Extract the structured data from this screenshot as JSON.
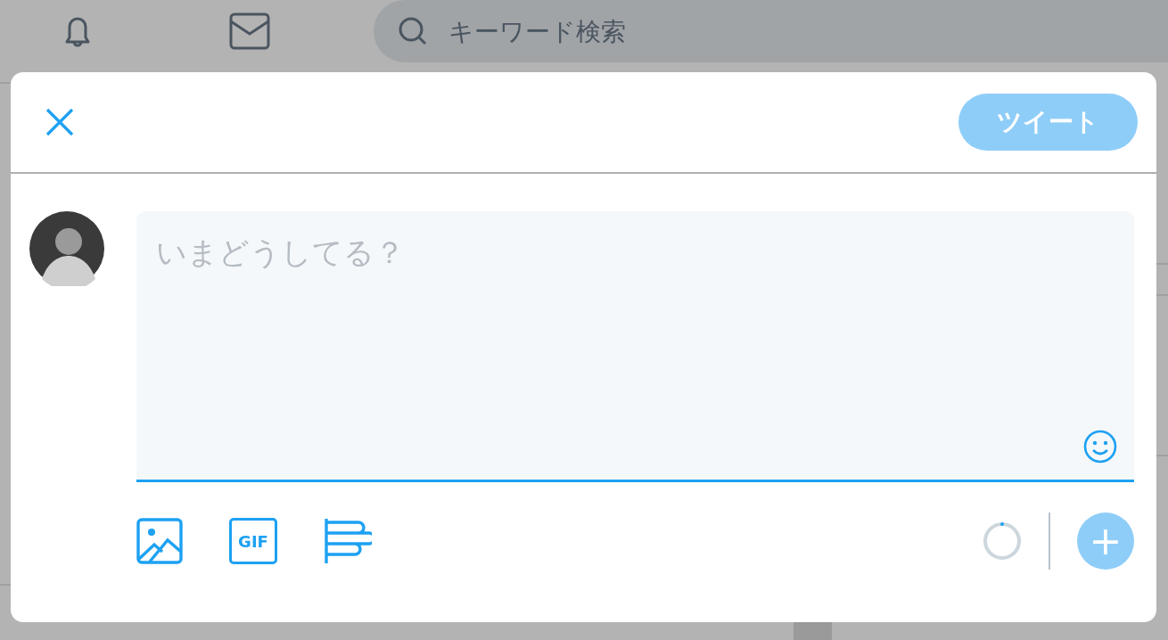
{
  "top_bar": {
    "search": {
      "placeholder": "キーワード検索"
    }
  },
  "compose": {
    "tweet_button": "ツイート",
    "placeholder": "いまどうしてる？",
    "gif_label": "GIF",
    "add_button": "+"
  }
}
